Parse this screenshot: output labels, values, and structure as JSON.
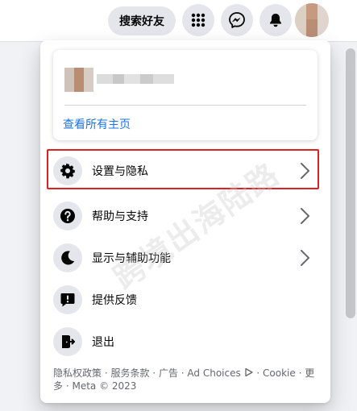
{
  "header": {
    "find_friends_label": "搜索好友",
    "icons": [
      "menu-grid-icon",
      "messenger-icon",
      "notifications-bell-icon"
    ]
  },
  "menu": {
    "see_all_profiles": "查看所有主页",
    "items": [
      {
        "label": "设置与隐私",
        "icon": "gear-icon",
        "has_chevron": true
      },
      {
        "label": "帮助与支持",
        "icon": "question-icon",
        "has_chevron": true
      },
      {
        "label": "显示与辅助功能",
        "icon": "moon-icon",
        "has_chevron": true
      },
      {
        "label": "提供反馈",
        "icon": "feedback-icon",
        "has_chevron": false
      },
      {
        "label": "退出",
        "icon": "logout-icon",
        "has_chevron": false
      }
    ],
    "footer": {
      "privacy": "隐私权政策",
      "terms": "服务条款",
      "ads": "广告",
      "ad_choices": "Ad Choices",
      "cookie": "Cookie",
      "more": "更多",
      "copyright": "Meta © 2023",
      "separator": " · "
    }
  },
  "overlay": {
    "watermark": "跨境出海陆路"
  },
  "colors": {
    "accent": "#1b74e4",
    "highlight_border": "#e02020"
  }
}
